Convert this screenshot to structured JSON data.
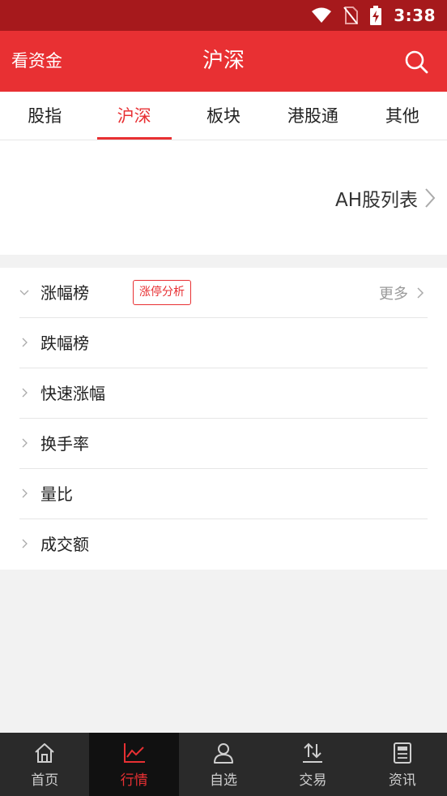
{
  "status_bar": {
    "time": "3:38"
  },
  "header": {
    "left_link": "看资金",
    "title": "沪深"
  },
  "tabs": [
    {
      "label": "股指"
    },
    {
      "label": "沪深"
    },
    {
      "label": "板块"
    },
    {
      "label": "港股通"
    },
    {
      "label": "其他"
    }
  ],
  "active_tab": "沪深",
  "ah_link": {
    "label": "AH股列表"
  },
  "list": {
    "items": [
      {
        "label": "涨幅榜",
        "badge": "涨停分析",
        "more": "更多",
        "expanded": true
      },
      {
        "label": "跌幅榜"
      },
      {
        "label": "快速涨幅"
      },
      {
        "label": "换手率"
      },
      {
        "label": "量比"
      },
      {
        "label": "成交额"
      }
    ]
  },
  "bottom_nav": [
    {
      "label": "首页",
      "icon": "home-icon"
    },
    {
      "label": "行情",
      "icon": "chart-icon",
      "active": true
    },
    {
      "label": "自选",
      "icon": "user-icon"
    },
    {
      "label": "交易",
      "icon": "trade-icon"
    },
    {
      "label": "资讯",
      "icon": "news-icon"
    }
  ],
  "colors": {
    "status_bar": "#a6191c",
    "brand_red": "#e83033",
    "nav_bg": "#2a2a2a",
    "nav_active_bg": "#111111"
  }
}
